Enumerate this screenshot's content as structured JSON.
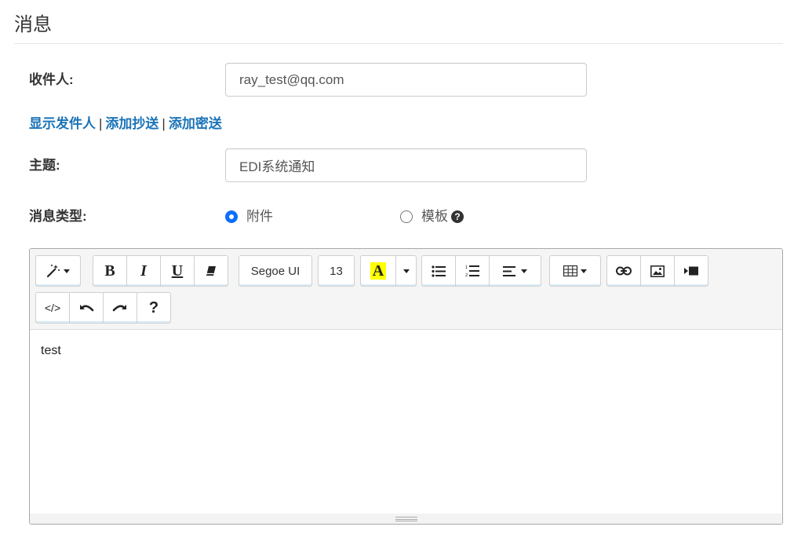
{
  "page": {
    "title": "消息"
  },
  "recipient": {
    "label": "收件人:",
    "value": "ray_test@qq.com"
  },
  "links": {
    "show_sender": "显示发件人",
    "separator": "|",
    "add_cc": "添加抄送",
    "add_bcc": "添加密送"
  },
  "subject": {
    "label": "主题:",
    "value": "EDI系统通知"
  },
  "message_type": {
    "label": "消息类型:",
    "options": [
      {
        "label": "附件",
        "checked": true
      },
      {
        "label": "模板",
        "checked": false
      }
    ],
    "help_icon": "question-circle-icon"
  },
  "editor": {
    "toolbar": {
      "style": {
        "icon": "magic-wand-icon"
      },
      "bold": "B",
      "italic": "I",
      "underline": "U",
      "clear_format": {
        "icon": "eraser-icon"
      },
      "font_name": "Segoe UI",
      "font_size": "13",
      "color": {
        "glyph": "A",
        "highlight": "#ffff00"
      },
      "unordered_list": {
        "icon": "bullet-list-icon"
      },
      "ordered_list": {
        "icon": "numbered-list-icon"
      },
      "paragraph": {
        "icon": "align-left-icon"
      },
      "table": {
        "icon": "table-icon"
      },
      "link": {
        "icon": "link-icon"
      },
      "picture": {
        "icon": "picture-icon"
      },
      "video": {
        "icon": "video-icon"
      },
      "code_view": "</>",
      "undo": {
        "icon": "undo-icon"
      },
      "redo": {
        "icon": "redo-icon"
      },
      "help": "?"
    },
    "content": "test"
  },
  "colors": {
    "link": "#1a73b8",
    "radio_checked": "#0d6efd",
    "toolbar_bg": "#f5f5f5"
  }
}
